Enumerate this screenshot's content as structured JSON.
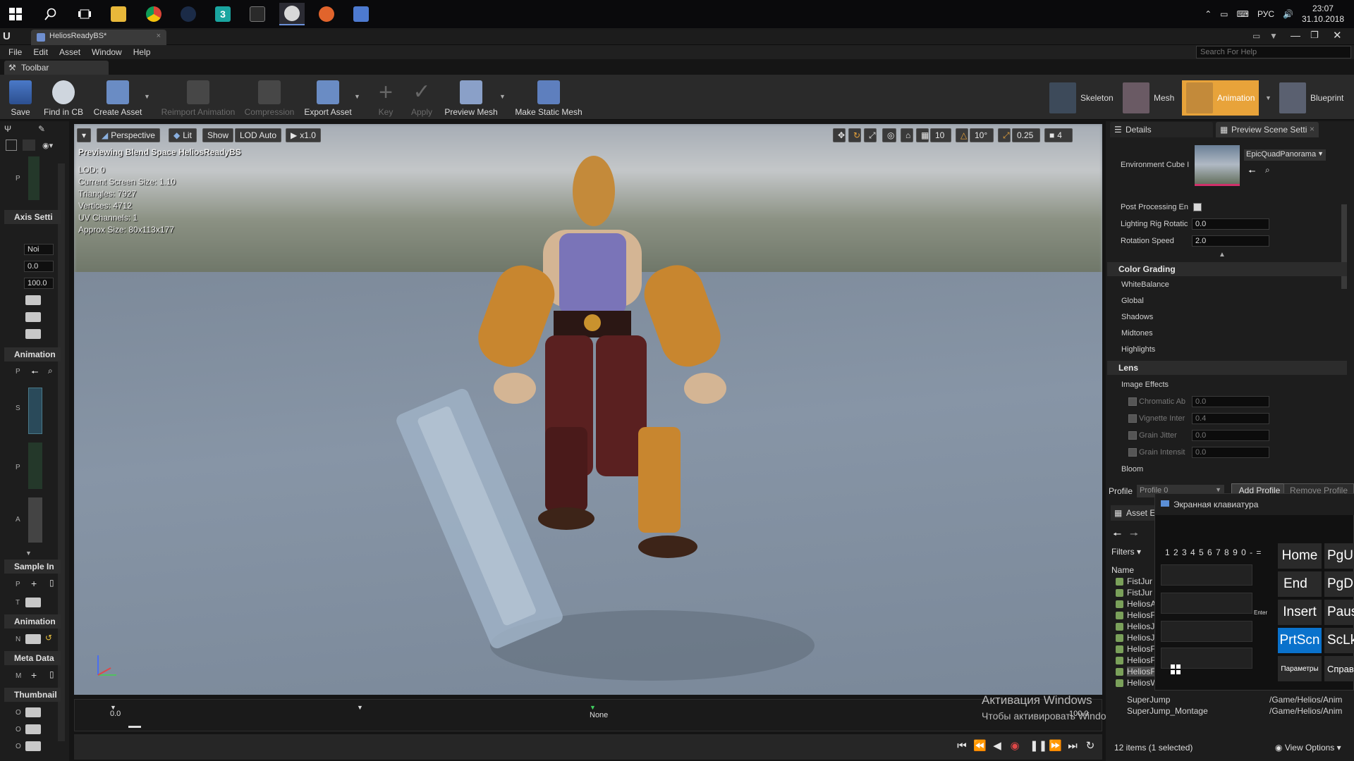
{
  "taskbar": {
    "icons": [
      "windows-start-icon",
      "search-icon",
      "task-view-icon",
      "file-explorer-icon",
      "chrome-icon",
      "steam-icon",
      "3ds-max-icon",
      "epic-games-icon",
      "unreal-engine-icon",
      "settings-app-icon",
      "network-app-icon"
    ],
    "tray": {
      "language": "РУС",
      "time": "23:07",
      "date": "31.10.2018"
    }
  },
  "document_tab": {
    "title": "HeliosReadyBS*"
  },
  "menu": {
    "file": "File",
    "edit": "Edit",
    "asset": "Asset",
    "window": "Window",
    "help": "Help"
  },
  "search_help": {
    "placeholder": "Search For Help"
  },
  "toolbar_tab": {
    "label": "Toolbar"
  },
  "toolbar": {
    "save": "Save",
    "find_in_cb": "Find in CB",
    "create_asset": "Create Asset",
    "reimport_animation": "Reimport Animation",
    "compression": "Compression",
    "export_asset": "Export Asset",
    "key": "Key",
    "apply": "Apply",
    "preview_mesh": "Preview Mesh",
    "make_static_mesh": "Make Static Mesh"
  },
  "modes": {
    "skeleton": "Skeleton",
    "mesh": "Mesh",
    "animation": "Animation",
    "blueprint": "Blueprint"
  },
  "left_panel": {
    "p_label": "P",
    "axis_settings": "Axis Setti",
    "axis_none": "Noi",
    "axis_min": "0.0",
    "axis_max": "100.0",
    "animation_1": "Animation",
    "anim_p": "P",
    "anim_s": "S",
    "anim_p2": "P",
    "anim_a": "A",
    "sample_interp": "Sample In",
    "sample_p": "P",
    "sample_t": "T",
    "animation_2": "Animation",
    "anim_n": "N",
    "meta_data": "Meta Data",
    "meta_m": "M",
    "thumbnail": "Thumbnail",
    "thumb_o1": "O",
    "thumb_o2": "O",
    "thumb_o3": "O"
  },
  "viewport": {
    "perspective": "Perspective",
    "lit": "Lit",
    "show": "Show",
    "lod_auto": "LOD Auto",
    "speed": "x1.0",
    "grid_snap": "10",
    "rot_snap": "10°",
    "scale_snap": "0.25",
    "camera_speed": "4",
    "previewing": "Previewing Blend Space HeliosReadyBS",
    "info": [
      "LOD: 0",
      "Current Screen Size: 1.10",
      "Triangles: 7927",
      "Vertices: 4712",
      "UV Channels: 1",
      "Approx Size: 80x113x177"
    ]
  },
  "timeline": {
    "start": "0.0",
    "mid": "None",
    "end": "100.0"
  },
  "windows_activation": {
    "line1": "Активация Windows",
    "line2": "Чтобы активировать Windows, перейдите в раздел \"Параметры\"."
  },
  "details": {
    "tab_details": "Details",
    "tab_preview": "Preview Scene Setti",
    "environment_cube": "Environment Cube I",
    "environment_value": "EpicQuadPanorama",
    "post_processing": "Post Processing En",
    "lighting_rig_rotation": "Lighting Rig Rotatic",
    "lighting_value": "0.0",
    "rotation_speed": "Rotation Speed",
    "rotation_value": "2.0",
    "color_grading": "Color Grading",
    "white_balance": "WhiteBalance",
    "global": "Global",
    "shadows": "Shadows",
    "midtones": "Midtones",
    "highlights": "Highlights",
    "lens": "Lens",
    "image_effects": "Image Effects",
    "chromatic": "Chromatic Ab",
    "chromatic_value": "0.0",
    "vignette": "Vignette Inter",
    "vignette_value": "0.4",
    "grain_jitter": "Grain Jitter",
    "grain_jitter_value": "0.0",
    "grain_intensity": "Grain Intensit",
    "grain_intensity_value": "0.0",
    "bloom": "Bloom",
    "profile_label": "Profile",
    "profile_value": "Profile 0",
    "add_profile": "Add Profile",
    "remove_profile": "Remove Profile"
  },
  "asset_browser": {
    "tab": "Asset E",
    "filters": "Filters",
    "name_header": "Name",
    "items": [
      "FistJur",
      "FistJur",
      "HeliosA",
      "HeliosF",
      "HeliosJ",
      "HeliosJ",
      "HeliosF",
      "HeliosF",
      "HeliosF",
      "HeliosW"
    ],
    "super_jump": "SuperJump",
    "super_jump_path": "/Game/Helios/Anim",
    "super_jump_montage": "SuperJump_Montage",
    "super_jump_montage_path": "/Game/Helios/Anim",
    "count": "12 items (1 selected)",
    "view_options": "View Options"
  },
  "osk": {
    "title": "Экранная клавиатура",
    "home": "Home",
    "pgup": "PgU",
    "end": "End",
    "pgdn": "PgD",
    "insert": "Insert",
    "pause": "Paus",
    "prtscn": "PrtScn",
    "scrlk": "ScLk",
    "params": "Параметры",
    "help": "Справ",
    "number_row": "1 2 3 4 5 6 7 8 9 0 -  =",
    "enter": "Enter"
  },
  "colors": {
    "accent_orange": "#e8a33a",
    "selection_blue": "#0a72cc",
    "panel_bg": "#1d1d1d"
  }
}
